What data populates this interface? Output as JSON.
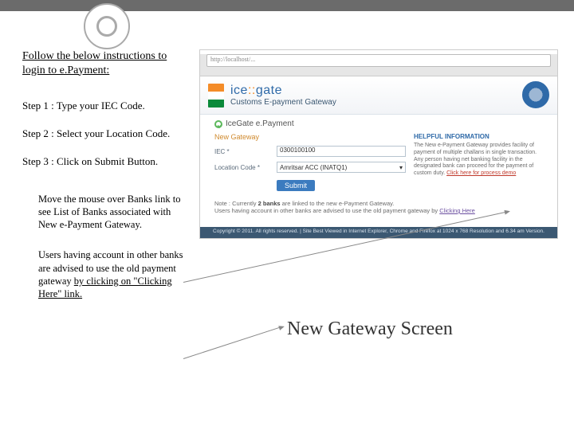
{
  "intro": "Follow the below instructions to login to e.Payment:",
  "steps": {
    "s1": "Step 1 : Type your IEC Code.",
    "s2": "Step 2 : Select your Location Code.",
    "s3": "Step 3 : Click on Submit Button."
  },
  "notes": {
    "n1": "Move the mouse over Banks link to see List of Banks associated with New e-Payment Gateway.",
    "n2_a": "Users having account in other banks are advised to use the old payment gateway ",
    "n2_b": "by clicking on \"Clicking Here\" link."
  },
  "caption": "New Gateway Screen",
  "browser": {
    "url": "http://localhost/..."
  },
  "site": {
    "brand_ice": "ice",
    "brand_dots": "::",
    "brand_gate": "gate",
    "brand_sub": "Customs E-payment Gateway",
    "tab_label": "IceGate e.Payment",
    "section": "New Gateway",
    "field1_label": "IEC *",
    "field1_value": "0300100100",
    "field2_label": "Location Code *",
    "field2_value": "Amritsar ACC (INATQ1)",
    "submit": "Submit",
    "info_title": "HELPFUL INFORMATION",
    "info_text": "The New e-Payment Gateway provides facility of payment of multiple challans in single transaction. Any person having net banking facility in the designated bank can proceed for the payment of custom duty.",
    "info_link": "Click here for process demo",
    "note_prefix": "Note : Currently ",
    "note_bold": "2 banks",
    "note_mid": " are linked to the new e-Payment Gateway.",
    "note_line2a": "Users having account in other banks are advised to use the old payment gateway by ",
    "note_link": "Clicking Here",
    "footer": "Copyright © 2011. All rights reserved. | Site Best Viewed in Internet Explorer, Chrome and Firefox at 1024 x 768 Resolution and 6.34 am Version."
  }
}
